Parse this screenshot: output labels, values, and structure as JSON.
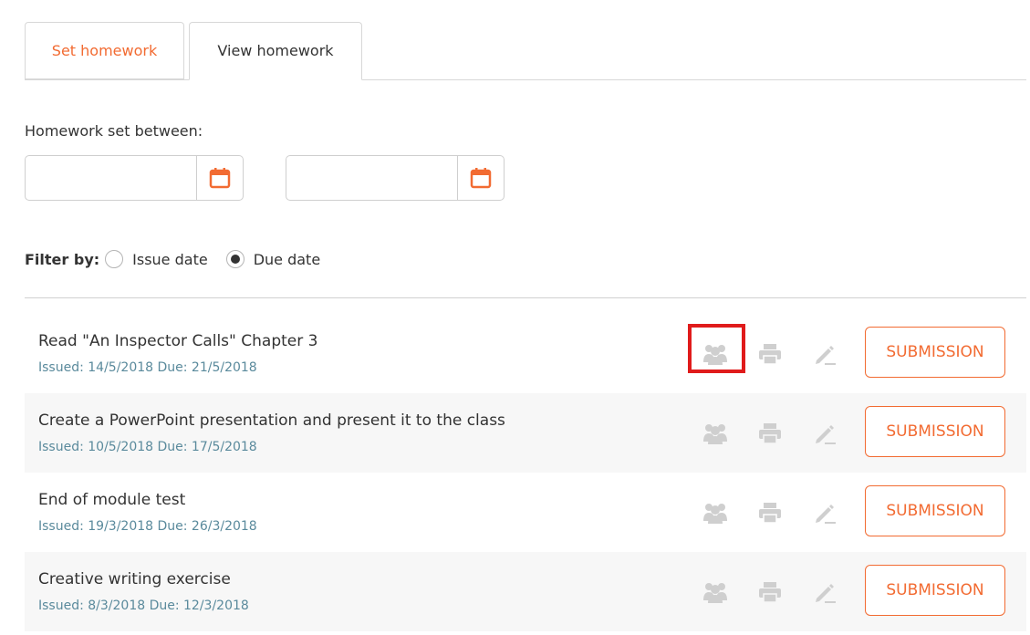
{
  "tabs": {
    "set_label": "Set homework",
    "view_label": "View homework"
  },
  "filters": {
    "between_label": "Homework set between:",
    "from_value": "",
    "to_value": "",
    "filter_by_label": "Filter by:",
    "issue_label": "Issue date",
    "due_label": "Due date",
    "selected": "Due date"
  },
  "homework": [
    {
      "title": "Read \"An Inspector Calls\" Chapter 3",
      "meta": "Issued: 14/5/2018 Due: 21/5/2018",
      "button": "SUBMISSION"
    },
    {
      "title": "Create a PowerPoint presentation and present it to the class",
      "meta": "Issued: 10/5/2018 Due: 17/5/2018",
      "button": "SUBMISSION"
    },
    {
      "title": "End of module test",
      "meta": "Issued: 19/3/2018 Due: 26/3/2018",
      "button": "SUBMISSION"
    },
    {
      "title": "Creative writing exercise",
      "meta": "Issued: 8/3/2018 Due: 12/3/2018",
      "button": "SUBMISSION"
    }
  ],
  "icons": {
    "people": "people-icon",
    "print": "print-icon",
    "edit": "pencil-icon",
    "calendar": "calendar-icon"
  },
  "colors": {
    "accent": "#f26b32",
    "meta_text": "#5a8a9c",
    "icon_gray": "#cfcfcf",
    "highlight": "#e01b1b"
  }
}
